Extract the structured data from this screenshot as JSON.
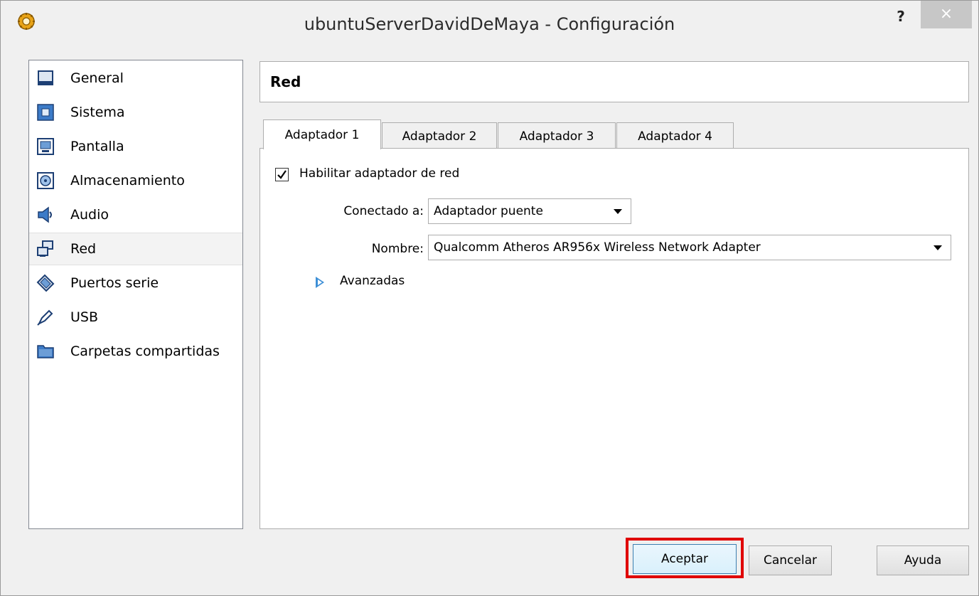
{
  "window": {
    "title": "ubuntuServerDavidDeMaya - Configuración",
    "help_label": "?",
    "close_label": "×"
  },
  "sidebar": {
    "items": [
      {
        "label": "General",
        "icon": "monitor-icon"
      },
      {
        "label": "Sistema",
        "icon": "chip-icon"
      },
      {
        "label": "Pantalla",
        "icon": "display-icon"
      },
      {
        "label": "Almacenamiento",
        "icon": "disk-icon"
      },
      {
        "label": "Audio",
        "icon": "speaker-icon"
      },
      {
        "label": "Red",
        "icon": "network-icon",
        "selected": true
      },
      {
        "label": "Puertos serie",
        "icon": "serial-port-icon"
      },
      {
        "label": "USB",
        "icon": "usb-icon"
      },
      {
        "label": "Carpetas compartidas",
        "icon": "folder-icon"
      }
    ]
  },
  "section": {
    "title": "Red"
  },
  "tabs": [
    {
      "label": "Adaptador 1",
      "active": true
    },
    {
      "label": "Adaptador 2"
    },
    {
      "label": "Adaptador 3"
    },
    {
      "label": "Adaptador 4"
    }
  ],
  "adapter": {
    "enable_label": "Habilitar adaptador de red",
    "enabled": true,
    "attached_label": "Conectado a:",
    "attached_value": "Adaptador puente",
    "name_label": "Nombre:",
    "name_value": "Qualcomm Atheros AR956x Wireless Network Adapter",
    "advanced_label": "Avanzadas"
  },
  "buttons": {
    "ok": "Aceptar",
    "cancel": "Cancelar",
    "help": "Ayuda"
  },
  "colors": {
    "highlight": "#e00000",
    "accent": "#3d8fd6"
  }
}
